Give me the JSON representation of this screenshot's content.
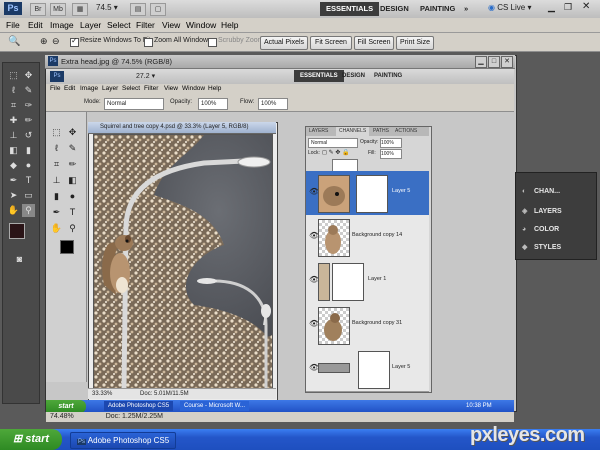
{
  "app": {
    "logo": "Ps",
    "zoom_dropdown": "74.5",
    "workspaces": [
      "ESSENTIALS",
      "DESIGN",
      "PAINTING"
    ],
    "more_glyph": "»",
    "cslive": "CS Live"
  },
  "menu": [
    "File",
    "Edit",
    "Image",
    "Layer",
    "Select",
    "Filter",
    "View",
    "Window",
    "Help"
  ],
  "options": {
    "resize_label": "Resize Windows To Fit",
    "zoom_all_label": "Zoom All Windows",
    "scrubby_label": "Scrubby Zoom",
    "buttons": [
      "Actual Pixels",
      "Fit Screen",
      "Fill Screen",
      "Print Size"
    ]
  },
  "outer_window": {
    "title": "Extra head.jpg @ 74.5% (RGB/8)"
  },
  "inner_app": {
    "workspaces": [
      "ESSENTIALS",
      "DESIGN",
      "PAINTING"
    ],
    "zoom": "27.2",
    "menu": [
      "File",
      "Edit",
      "Image",
      "Layer",
      "Select",
      "Filter",
      "View",
      "Window",
      "Help"
    ],
    "mode_label": "Mode:",
    "mode_value": "Normal",
    "opacity_label": "Opacity:",
    "opacity_value": "100%",
    "flow_label": "Flow:",
    "flow_value": "100%"
  },
  "doc": {
    "title": "Squirrel and tree copy 4.psd @ 33.3% (Layer 5, RGB/8)",
    "zoom": "33.33%",
    "info": "Doc: 5.01M/11.5M"
  },
  "layers_panel": {
    "tabs": [
      "LAYERS",
      "CHANNELS",
      "PATHS",
      "ACTIONS"
    ],
    "blend": "Normal",
    "opacity_label": "Opacity:",
    "opacity": "100%",
    "lock_label": "Lock:",
    "fill_label": "Fill:",
    "fill": "100%",
    "layers": [
      {
        "name": "Layer 5"
      },
      {
        "name": "Background copy 14"
      },
      {
        "name": "Layer 1"
      },
      {
        "name": "Background copy 31"
      },
      {
        "name": "Layer 5"
      }
    ]
  },
  "dock": {
    "items": [
      "CHAN...",
      "LAYERS",
      "COLOR",
      "STYLES"
    ]
  },
  "inner_taskbar": {
    "start": "start",
    "items": [
      "Adobe Photoshop CS5",
      "Course - Microsoft W..."
    ],
    "clock": "10:38 PM"
  },
  "status": {
    "zoom": "74.48%",
    "info": "Doc: 1.25M/2.25M"
  },
  "taskbar": {
    "start": "start",
    "items": [
      "Adobe Photoshop CS5"
    ],
    "watermark": "pxleyes.com"
  }
}
